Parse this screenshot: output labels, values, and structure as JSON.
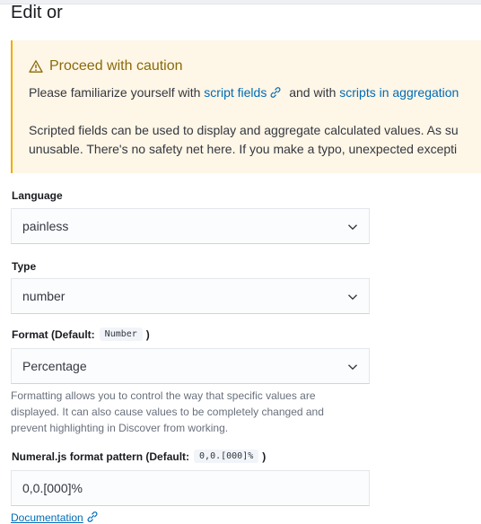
{
  "page": {
    "title": "Edit or"
  },
  "callout": {
    "title": "Proceed with caution",
    "line1_before": "Please familiarize yourself with",
    "line1_link1": "script fields",
    "line1_middle": "and with",
    "line1_link2": "scripts in aggregation",
    "line2": "Scripted fields can be used to display and aggregate calculated values. As su",
    "line3": "unusable. There's no safety net here. If you make a typo, unexpected excepti"
  },
  "language": {
    "label": "Language",
    "value": "painless"
  },
  "type": {
    "label": "Type",
    "value": "number"
  },
  "format": {
    "label": "Format (Default:",
    "default_chip": "Number",
    "label_close": ")",
    "value": "Percentage",
    "help": "Formatting allows you to control the way that specific values are displayed. It can also cause values to be completely changed and prevent highlighting in Discover from working."
  },
  "numeral": {
    "label": "Numeral.js format pattern (Default:",
    "default_chip": "0,0.[000]%",
    "label_close": ")",
    "value": "0,0.[000]%",
    "doc_link": "Documentation"
  },
  "colors": {
    "warning": "#f5a700",
    "link": "#006bb8"
  },
  "icons": {
    "callout": "alert-triangle-icon",
    "link": "link-icon",
    "select": "chevron-down-icon"
  }
}
